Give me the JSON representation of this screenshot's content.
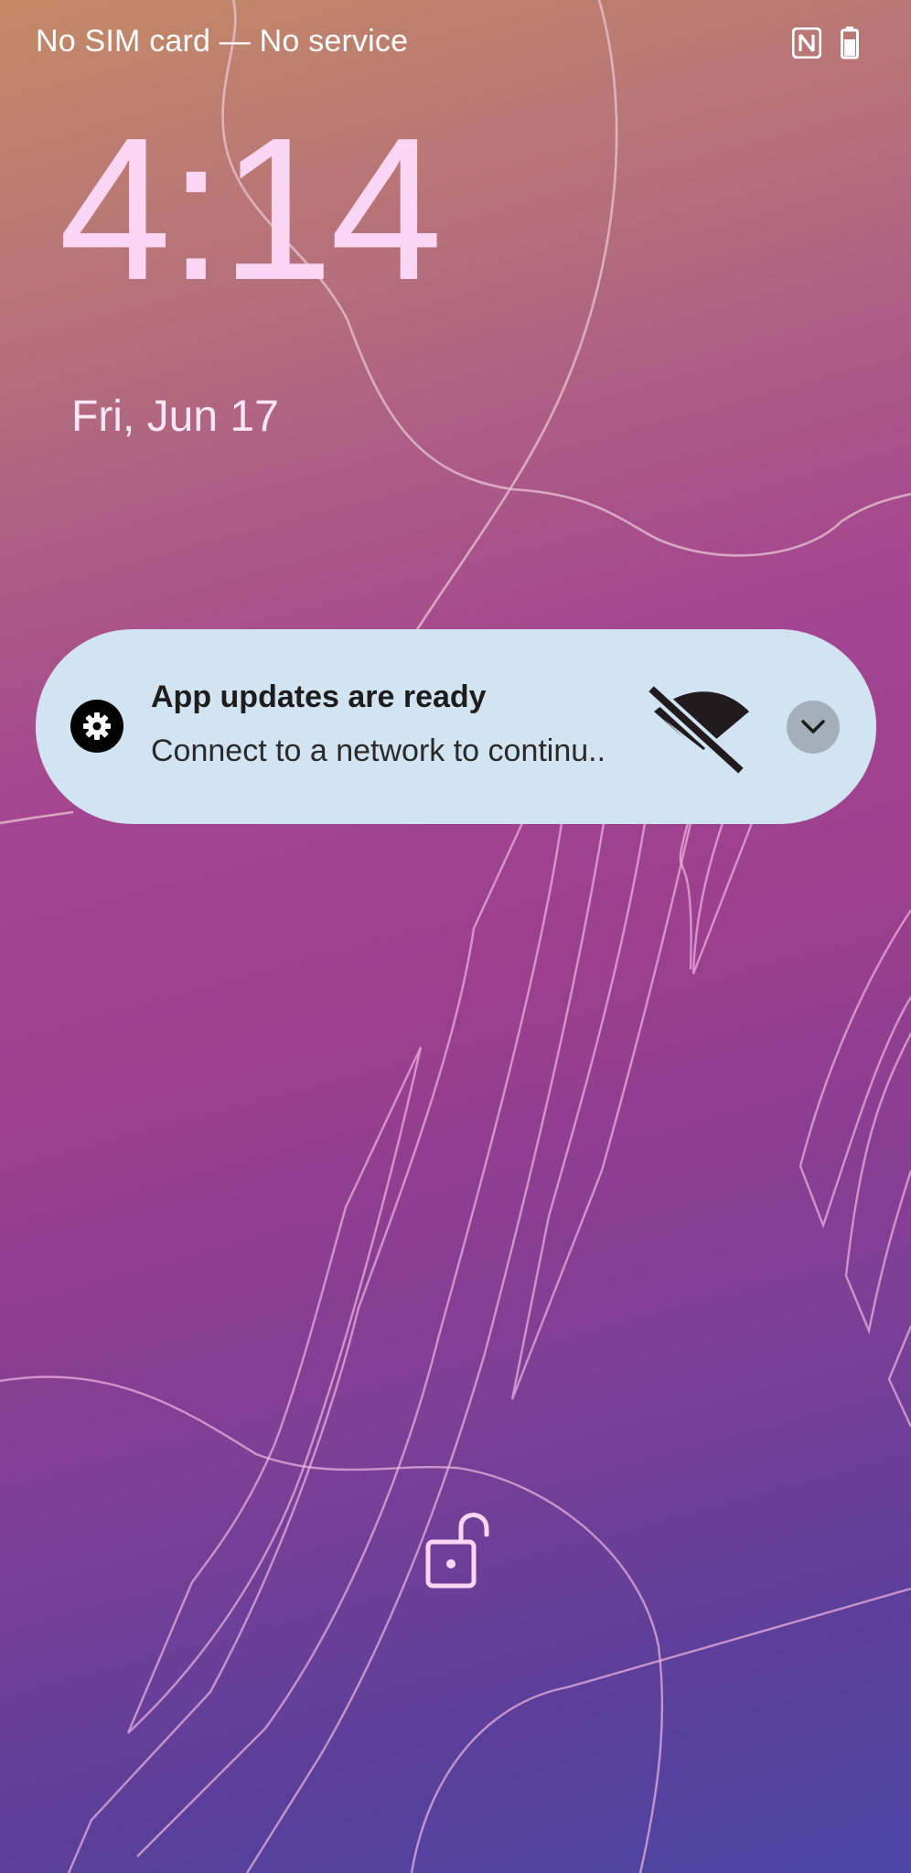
{
  "status_bar": {
    "carrier": "No SIM card — No service",
    "icons": [
      "nfc-icon",
      "battery-icon"
    ]
  },
  "lockscreen": {
    "time": "4:14",
    "date": "Fri, Jun 17"
  },
  "notification": {
    "app_icon": "settings-gear-icon",
    "title": "App updates are ready",
    "text": "Connect to a network to continu..",
    "large_icon": "wifi-off-icon",
    "expand_icon": "chevron-down-icon",
    "background_color": "#d2e3f2"
  },
  "bottom": {
    "icon": "unlocked-padlock-icon"
  },
  "colors": {
    "clock": "#fbd6f4",
    "lock_icon": "#fbd6f4"
  }
}
